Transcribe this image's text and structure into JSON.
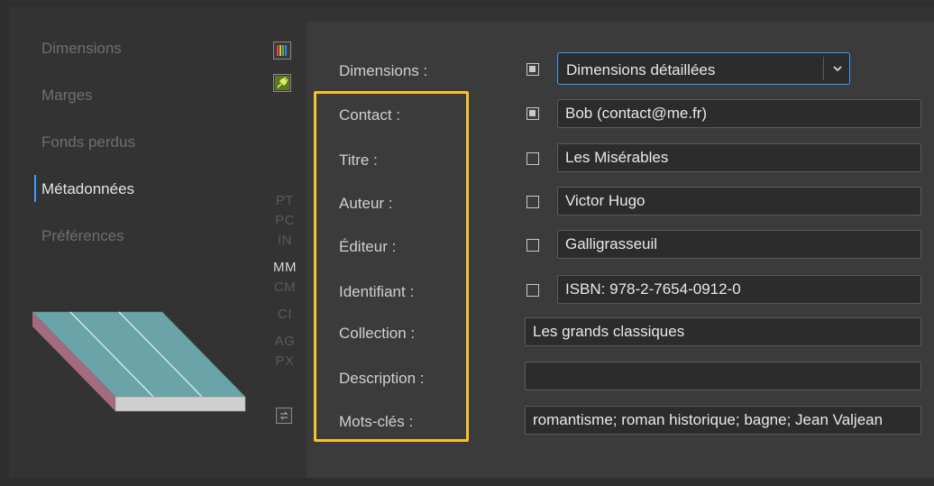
{
  "nav": {
    "items": [
      {
        "label": "Dimensions",
        "active": false
      },
      {
        "label": "Marges",
        "active": false
      },
      {
        "label": "Fonds perdus",
        "active": false
      },
      {
        "label": "Métadonnées",
        "active": true
      },
      {
        "label": "Préférences",
        "active": false
      }
    ]
  },
  "units": {
    "items": [
      "PT",
      "PC",
      "IN",
      "MM",
      "CM",
      "CI",
      "AG",
      "PX"
    ],
    "selected": "MM"
  },
  "icons": {
    "top_tool": "color-bars-icon",
    "second_tool": "plug-icon",
    "bottom_tool": "swap-icon",
    "book_preview": "book-preview-icon",
    "select_chevron": "chevron-down-icon"
  },
  "colors": {
    "accent": "#3d9bff",
    "highlight": "#f4c430",
    "book_top": "#6aa4a8",
    "book_spine": "#a36a80",
    "book_pages": "#cfcfcf"
  },
  "form": {
    "fields": [
      {
        "label": "Dimensions :",
        "checked": true,
        "value": "Dimensions détaillées",
        "type": "select"
      },
      {
        "label": "Contact :",
        "checked": true,
        "value": "Bob (contact@me.fr)",
        "type": "text"
      },
      {
        "label": "Titre :",
        "checked": false,
        "value": "Les Misérables",
        "type": "text"
      },
      {
        "label": "Auteur :",
        "checked": false,
        "value": "Victor Hugo",
        "type": "text"
      },
      {
        "label": "Éditeur :",
        "checked": false,
        "value": "Galligrasseuil",
        "type": "text"
      },
      {
        "label": "Identifiant :",
        "checked": false,
        "value": "ISBN: 978-2-7654-0912-0",
        "type": "text"
      },
      {
        "label": "Collection :",
        "value": "Les grands classiques",
        "type": "text"
      },
      {
        "label": "Description :",
        "value": "",
        "type": "text"
      },
      {
        "label": "Mots-clés :",
        "value": "romantisme; roman historique; bagne; Jean Valjean",
        "type": "text"
      }
    ]
  }
}
